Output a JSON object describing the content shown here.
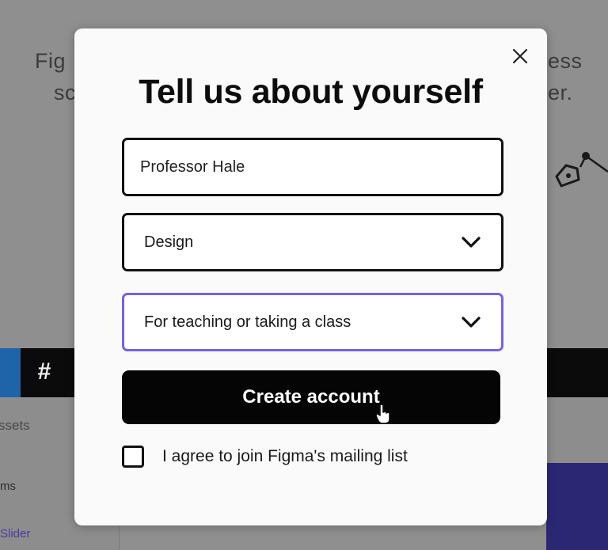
{
  "background": {
    "hero_line1_left": "Fig",
    "hero_line1_right": "ess",
    "hero_line2_left": "sc",
    "hero_line2_right": "er.",
    "panel_tab": "ssets",
    "panel_item_1": "ms",
    "panel_item_2": "Slider",
    "toolbar_frame_icon": "hash-frame-icon",
    "pen_icon": "pen-tool-icon"
  },
  "dialog": {
    "close_icon": "close-icon",
    "title": "Tell us about yourself",
    "name_field": {
      "value": "Professor Hale"
    },
    "role_select": {
      "value": "Design",
      "icon": "chevron-down-icon"
    },
    "usage_select": {
      "value": "For teaching or taking a class",
      "icon": "chevron-down-icon",
      "focused": true
    },
    "submit_label": "Create account",
    "mailing_list": {
      "label": "I agree to join Figma's mailing list",
      "checked": false
    }
  },
  "colors": {
    "focus_border": "#7561e8",
    "button_bg": "#050505",
    "overlay": "#8f8f8f"
  }
}
